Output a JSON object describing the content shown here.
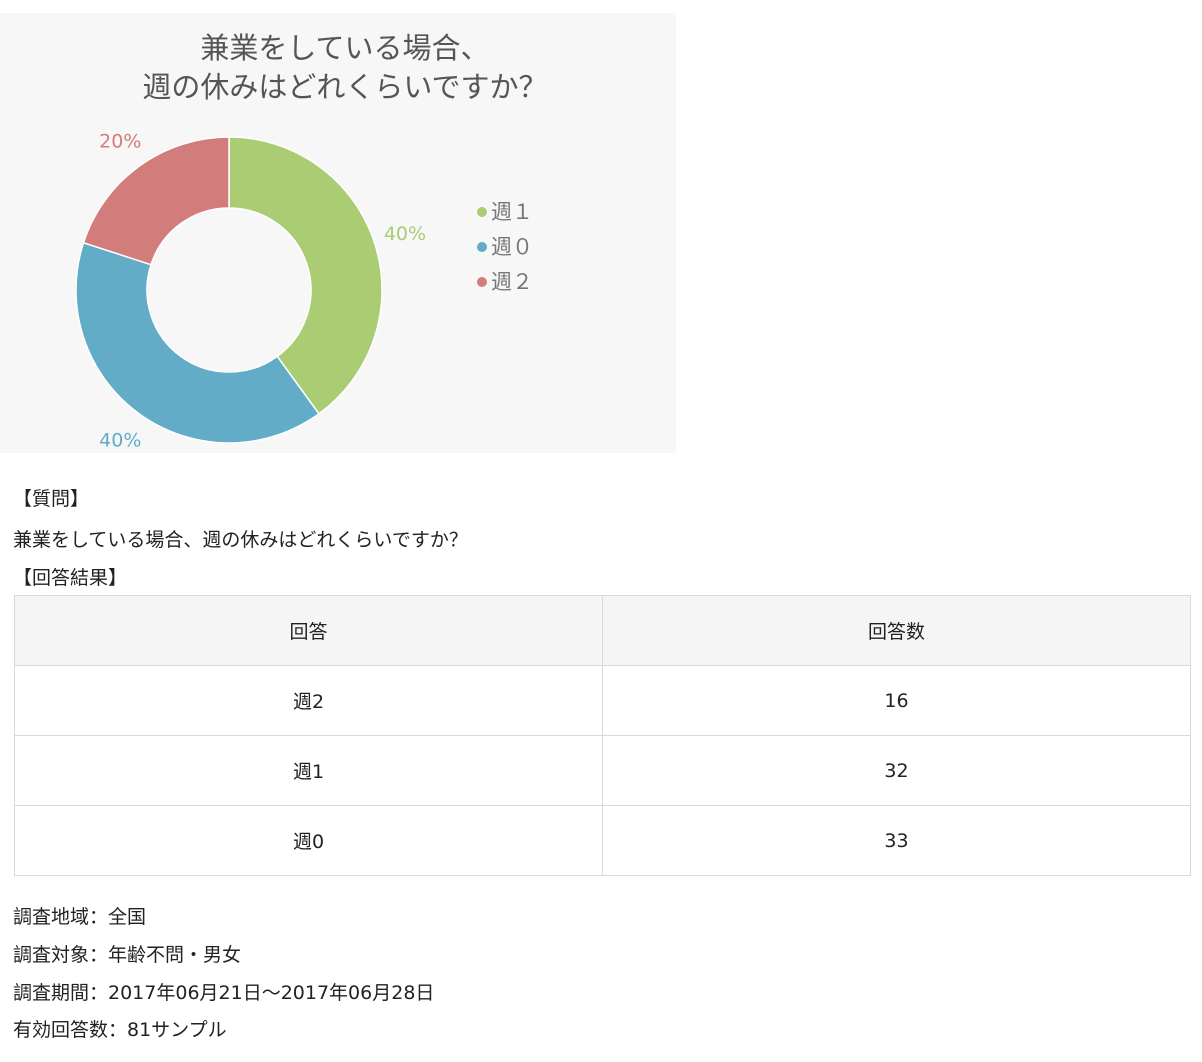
{
  "chart_data": {
    "type": "donut",
    "title_lines": [
      "兼業をしている場合、",
      "週の休みはどれくらいですか？"
    ],
    "slices": [
      {
        "label": "週１",
        "percent": 40,
        "percent_label": "40%",
        "color": "#aacc73"
      },
      {
        "label": "週０",
        "percent": 40,
        "percent_label": "40%",
        "color": "#62acc7"
      },
      {
        "label": "週２",
        "percent": 20,
        "percent_label": "20%",
        "color": "#d37c7c"
      }
    ],
    "legend": {
      "position": "right",
      "items": [
        "週１",
        "週０",
        "週２"
      ]
    },
    "colors": {
      "panel_background": "#f7f7f7",
      "title": "#555555",
      "legend_text": "#777777"
    }
  },
  "question_header": "【質問】",
  "question_text": "兼業をしている場合、週の休みはどれくらいですか？",
  "result_header": "【回答結果】",
  "table": {
    "headers": [
      "回答",
      "回答数"
    ],
    "rows": [
      [
        "週2",
        "16"
      ],
      [
        "週1",
        "32"
      ],
      [
        "週0",
        "33"
      ]
    ]
  },
  "survey_info": [
    "調査地域：全国",
    "調査対象：年齢不問・男女",
    "調査期間：2017年06月21日～2017年06月28日",
    "有効回答数：81サンプル"
  ]
}
